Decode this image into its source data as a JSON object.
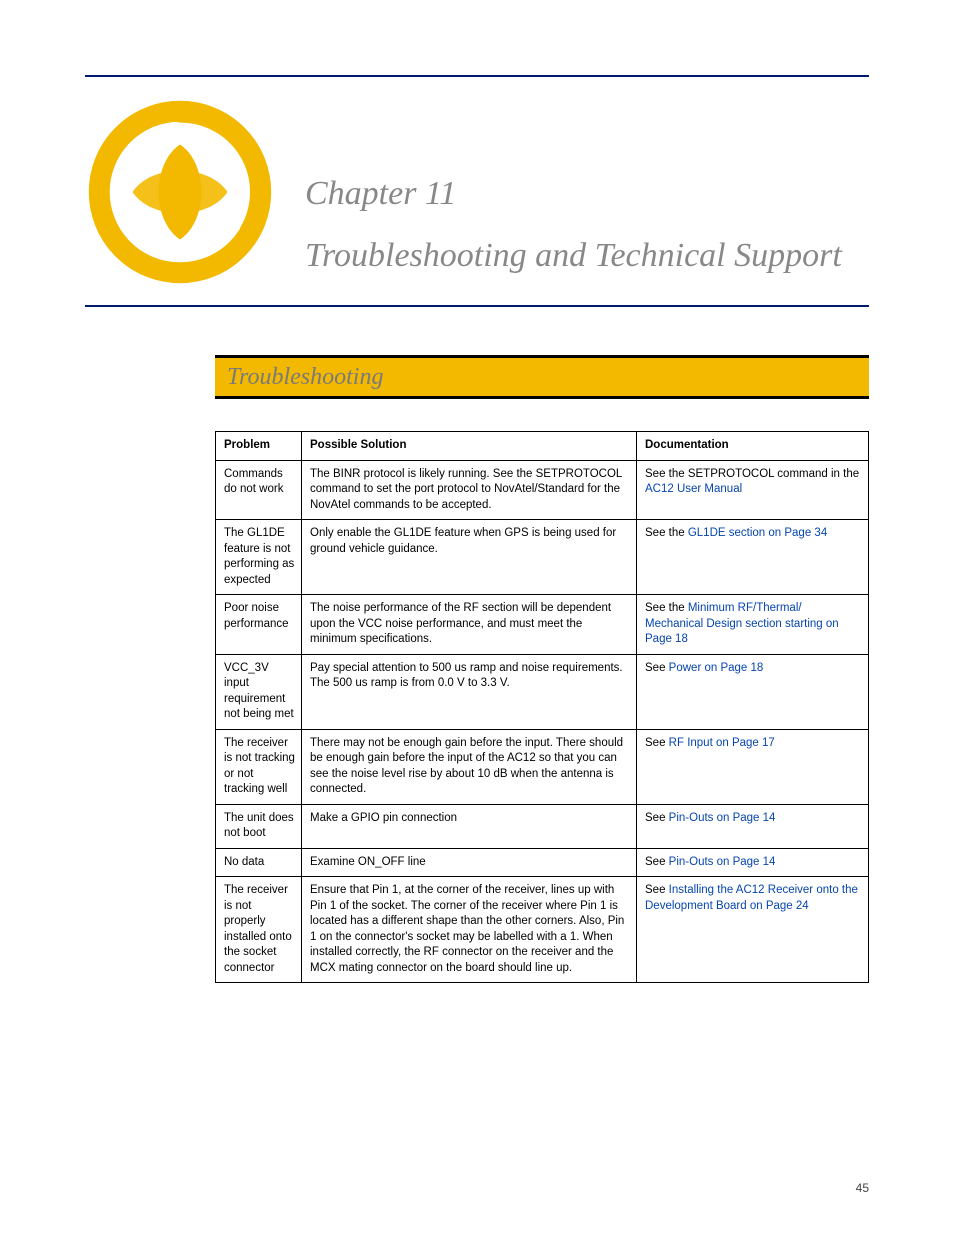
{
  "chapter": {
    "label": "Chapter 11",
    "title": "Troubleshooting and Technical Support"
  },
  "section_title": "Troubleshooting",
  "table": {
    "headers": [
      "Problem",
      "Possible Solution",
      "Documentation"
    ],
    "rows": [
      {
        "problem": "Commands do not work",
        "solution": "The BINR protocol is likely running. See the SETPROTOCOL command to set the port protocol to NovAtel/Standard for the NovAtel commands to be accepted.",
        "doc_text": "See the SETPROTOCOL command in the",
        "doc_link_text": "AC12 User Manual",
        "doc_suffix": ""
      },
      {
        "problem": "The GL1DE feature is not performing as expected",
        "solution": "Only enable the GL1DE feature when GPS is being used for ground vehicle guidance.",
        "doc_text": "See the",
        "doc_link_text": "GL1DE section on Page 34",
        "doc_suffix": ""
      },
      {
        "problem": "Poor noise performance",
        "solution": "The noise performance of the RF section will be dependent upon the VCC noise performance, and must meet the minimum specifications.",
        "doc_text": "See the",
        "doc_link_text": "Minimum RF/Thermal/ Mechanical Design section starting on Page 18",
        "doc_suffix": ""
      },
      {
        "problem": "VCC_3V input requirement not being met",
        "solution": "Pay special attention to 500 us ramp and noise requirements. The 500 us ramp is from 0.0 V to 3.3 V.",
        "doc_text": "See",
        "doc_link_text": "Power on Page 18",
        "doc_suffix": ""
      },
      {
        "problem": "The receiver is not tracking or not tracking well",
        "solution": "There may not be enough gain before the input. There should be enough gain before the input of the AC12 so that you can see the noise level rise by about 10 dB when the antenna is connected.",
        "doc_text": "See",
        "doc_link_text": "RF Input on Page 17",
        "doc_suffix": ""
      },
      {
        "problem": "The unit does not boot",
        "solution": "Make a GPIO pin connection",
        "doc_text": "See",
        "doc_link_text": "Pin-Outs on Page 14",
        "doc_suffix": ""
      },
      {
        "problem": "No data",
        "solution": "Examine ON_OFF line",
        "doc_text": "See",
        "doc_link_text": "Pin-Outs on Page 14",
        "doc_suffix": ""
      },
      {
        "problem": "The receiver is not properly installed onto the socket connector",
        "solution": "Ensure that Pin 1, at the corner of the receiver, lines up with Pin 1 of the socket. The corner of the receiver where Pin 1 is located has a different shape than the other corners. Also, Pin 1 on the connector's socket may be labelled with a 1. When installed correctly, the RF connector on the receiver and the MCX mating connector on the board should line up.",
        "doc_text": "See",
        "doc_link_text": "Installing the AC12 Receiver onto the Development Board on Page 24",
        "doc_suffix": ""
      }
    ]
  },
  "page_number": "45"
}
